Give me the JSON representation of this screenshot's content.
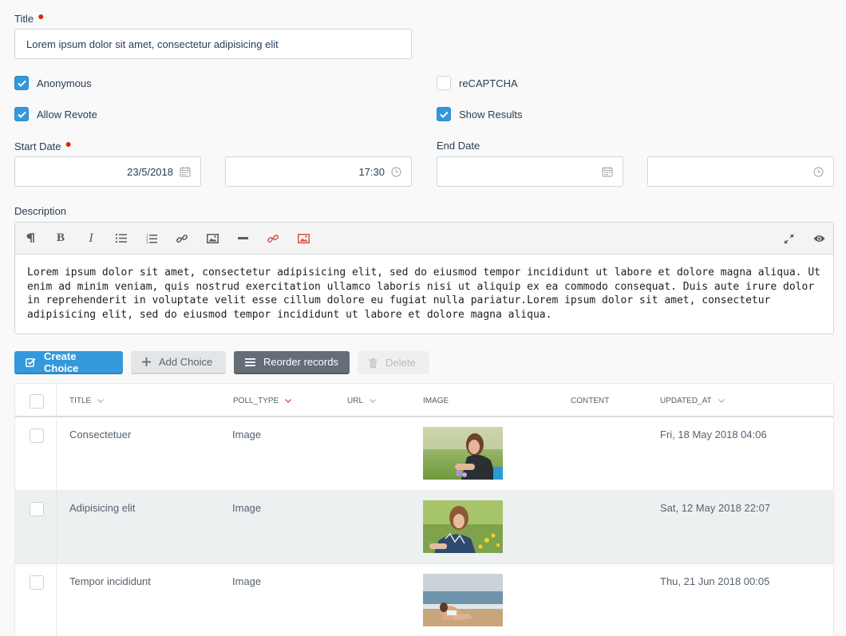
{
  "title_field": {
    "label": "Title",
    "value": "Lorem ipsum dolor sit amet, consectetur adipisicing elit"
  },
  "checkboxes": [
    {
      "label": "Anonymous",
      "checked": true
    },
    {
      "label": "reCAPTCHA",
      "checked": false
    },
    {
      "label": "Allow Revote",
      "checked": true
    },
    {
      "label": "Show Results",
      "checked": true
    }
  ],
  "start_date": {
    "label": "Start Date",
    "date": "23/5/2018",
    "time": "17:30"
  },
  "end_date": {
    "label": "End Date",
    "date": "",
    "time": ""
  },
  "description": {
    "label": "Description",
    "toolbar": [
      "paragraph-icon",
      "bold-icon",
      "italic-icon",
      "bullet-list-icon",
      "numbered-list-icon",
      "link-icon",
      "image-icon",
      "horizontal-rule-icon",
      "media-link-icon",
      "media-image-icon",
      "fullscreen-icon",
      "preview-icon"
    ],
    "content": "Lorem ipsum dolor sit amet, consectetur adipisicing elit, sed do eiusmod tempor incididunt ut labore et dolore magna aliqua. Ut enim ad minim veniam, quis nostrud exercitation ullamco laboris nisi ut aliquip ex ea commodo consequat. Duis aute irure dolor in reprehenderit in voluptate velit esse cillum dolore eu fugiat nulla pariatur.Lorem ipsum dolor sit amet, consectetur adipisicing elit, sed do eiusmod tempor incididunt ut labore et dolore magna aliqua."
  },
  "actions": {
    "create": "Create Choice",
    "add": "Add Choice",
    "reorder": "Reorder records",
    "delete": "Delete"
  },
  "table": {
    "columns": [
      "TITLE",
      "POLL_TYPE",
      "URL",
      "IMAGE",
      "CONTENT",
      "UPDATED_AT"
    ],
    "rows": [
      {
        "title": "Consectetuer",
        "poll_type": "Image",
        "updated_at": "Fri, 18 May 2018 04:06"
      },
      {
        "title": "Adipisicing elit",
        "poll_type": "Image",
        "updated_at": "Sat, 12 May 2018 22:07"
      },
      {
        "title": "Tempor incididunt",
        "poll_type": "Image",
        "updated_at": "Thu, 21 Jun 2018 00:05"
      }
    ]
  },
  "colors": {
    "primary": "#3498db",
    "dark_button": "#656d79",
    "required": "#cc3300",
    "sort_active": "#d9534f"
  }
}
